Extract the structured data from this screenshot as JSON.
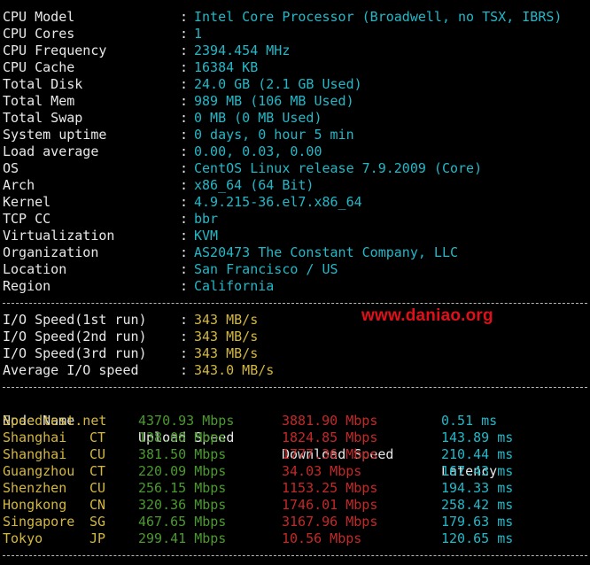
{
  "colors": {
    "background": "#000000",
    "label": "#e8e8e8",
    "value_teal": "#22b8c8",
    "value_yellow": "#d4b73e",
    "upload_green": "#4a9a2e",
    "download_red": "#c42828",
    "latency_cyan": "#22b8c8",
    "watermark_red": "#e0101a"
  },
  "sysinfo": [
    {
      "key": "CPU Model",
      "value": "Intel Core Processor (Broadwell, no TSX, IBRS)"
    },
    {
      "key": "CPU Cores",
      "value": "1"
    },
    {
      "key": "CPU Frequency",
      "value": "2394.454 MHz"
    },
    {
      "key": "CPU Cache",
      "value": "16384 KB"
    },
    {
      "key": "Total Disk",
      "value": "24.0 GB (2.1 GB Used)"
    },
    {
      "key": "Total Mem",
      "value": "989 MB (106 MB Used)"
    },
    {
      "key": "Total Swap",
      "value": "0 MB (0 MB Used)"
    },
    {
      "key": "System uptime",
      "value": "0 days, 0 hour 5 min"
    },
    {
      "key": "Load average",
      "value": "0.00, 0.03, 0.00"
    },
    {
      "key": "OS",
      "value": "CentOS Linux release 7.9.2009 (Core)"
    },
    {
      "key": "Arch",
      "value": "x86_64 (64 Bit)"
    },
    {
      "key": "Kernel",
      "value": "4.9.215-36.el7.x86_64"
    },
    {
      "key": "TCP CC",
      "value": "bbr"
    },
    {
      "key": "Virtualization",
      "value": "KVM"
    },
    {
      "key": "Organization",
      "value": "AS20473 The Constant Company, LLC"
    },
    {
      "key": "Location",
      "value": "San Francisco / US"
    },
    {
      "key": "Region",
      "value": "California"
    }
  ],
  "colon": ":",
  "io": [
    {
      "key": "I/O Speed(1st run)",
      "value": "343 MB/s"
    },
    {
      "key": "I/O Speed(2nd run)",
      "value": "343 MB/s"
    },
    {
      "key": "I/O Speed(3rd run)",
      "value": "343 MB/s"
    },
    {
      "key": "Average I/O speed",
      "value": "343.0 MB/s"
    }
  ],
  "watermark": "www.daniao.org",
  "speed": {
    "headers": {
      "node": "Node Name",
      "upload": "Upload Speed",
      "download": "Download Speed",
      "latency": "Latency"
    },
    "rows": [
      {
        "node": "Speedtest.net",
        "loc": "",
        "upload": "4370.93 Mbps",
        "download": "3881.90 Mbps",
        "latency": "0.51 ms"
      },
      {
        "node": "Shanghai",
        "loc": "CT",
        "upload": "138.08 Mbps",
        "download": "1824.85 Mbps",
        "latency": "143.89 ms"
      },
      {
        "node": "Shanghai",
        "loc": "CU",
        "upload": "381.50 Mbps",
        "download": "1777.36 Mbps",
        "latency": "210.44 ms"
      },
      {
        "node": "Guangzhou",
        "loc": "CT",
        "upload": "220.09 Mbps",
        "download": "34.03 Mbps",
        "latency": "167.43 ms"
      },
      {
        "node": "Shenzhen",
        "loc": "CU",
        "upload": "256.15 Mbps",
        "download": "1153.25 Mbps",
        "latency": "194.33 ms"
      },
      {
        "node": "Hongkong",
        "loc": "CN",
        "upload": "320.36 Mbps",
        "download": "1746.01 Mbps",
        "latency": "258.42 ms"
      },
      {
        "node": "Singapore",
        "loc": "SG",
        "upload": "467.65 Mbps",
        "download": "3167.96 Mbps",
        "latency": "179.63 ms"
      },
      {
        "node": "Tokyo",
        "loc": "JP",
        "upload": "299.41 Mbps",
        "download": "10.56 Mbps",
        "latency": "120.65 ms"
      }
    ]
  }
}
